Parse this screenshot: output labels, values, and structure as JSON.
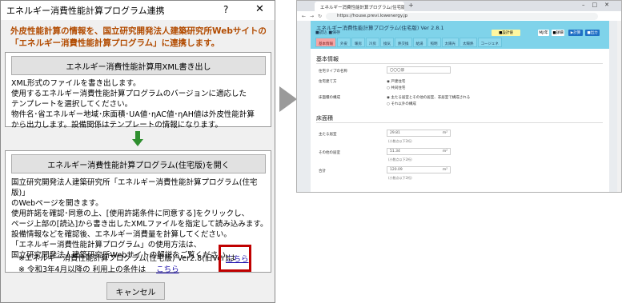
{
  "dialog": {
    "title": "エネルギー消費性能計算プログラム連携",
    "help": "?",
    "close": "✕",
    "lead": [
      "外皮性能計算の情報を、国立研究開発法人建築研究所Webサイトの",
      "「エネルギー消費性能計算プログラム」に連携します。"
    ],
    "export_button": "エネルギー消費性能計算用XML書き出し",
    "export_text": [
      "XML形式のファイルを書き出します。",
      "使用するエネルギー消費性能計算プログラムのバージョンに適応した",
      "テンプレートを選択してください。",
      "物件名･省エネルギー地域･床面積･UA値･ηAC値･ηAH値は外皮性能計算",
      "から出力します。設備関係はテンプレートの情報になります。"
    ],
    "open_button": "エネルギー消費性能計算プログラム(住宅版)を開く",
    "open_text": [
      "国立研究開発法人建築研究所「エネルギー消費性能計算プログラム(住宅版)」",
      "のWebページを開きます。",
      "使用許諾を確認･同意の上、[使用許諾条件に同意する]をクリックし、",
      "ページ上部の[読込]から書き出したXMLファイルを指定して読み込みます。",
      "設備情報などを確認後、エネルギー消費量を計算してください。",
      "「エネルギー消費性能計算プログラム」の使用方法は、",
      "国立研究開発法人建築研究所Webサイトの解説をご覧ください。"
    ],
    "note1": "※エネルギー消費性能計算プログラム(住宅版) Ver2.8(旧Ver)は",
    "note1_link": "こちら",
    "note2": "※ 令和3年4月以降の 利用上の条件は",
    "note2_link": "こちら",
    "cancel": "キャンセル",
    "colors": {
      "lead": "#b24b00",
      "highlight": "#c00000",
      "link": "#1a0dab"
    }
  },
  "browser": {
    "tab_title": "エネルギー消費性能計算プログラム(住宅版)",
    "new_tab": "+",
    "window_controls": "–□✕",
    "nav": "←→↻",
    "url": "https://house.previ.lowenergy.jp",
    "app_title": "エネルギー消費性能計算プログラム(住宅版) Ver 2.8.1",
    "header_buttons": "■読込  ■保存",
    "header_right": [
      "■設計値",
      "MJ/年",
      "■詳細",
      "▶計算",
      "■出力"
    ],
    "page_tabs": [
      "基本情報",
      "外皮",
      "暖房",
      "冷房",
      "換気",
      "熱交換",
      "給湯",
      "照明",
      "太陽光",
      "太陽熱",
      "コージェネ"
    ],
    "basic_section": "基本情報",
    "fields": [
      {
        "label": "住宅タイプの名称",
        "value": "〇〇〇邸"
      },
      {
        "label": "住宅建て方",
        "value": ""
      },
      {
        "label": "床面積の構成",
        "value": ""
      }
    ],
    "radios": [
      "戸建住宅",
      "共同住宅",
      "主たる居室とその他の居室、非居室で構成される",
      "それ以外の構成"
    ],
    "area_section": "床面積",
    "areas": [
      {
        "label": "主たる居室",
        "value": "29.81",
        "unit": "m²",
        "hint": "(小数点以下2桁)"
      },
      {
        "label": "その他の居室",
        "value": "51.34",
        "unit": "m²",
        "hint": "(小数点以下2桁)"
      },
      {
        "label": "合計",
        "value": "120.09",
        "unit": "m²",
        "hint": "(小数点以下2桁)"
      }
    ],
    "colors": {
      "header": "#7fd3ea",
      "active_tab": "#f6a5a5"
    }
  }
}
